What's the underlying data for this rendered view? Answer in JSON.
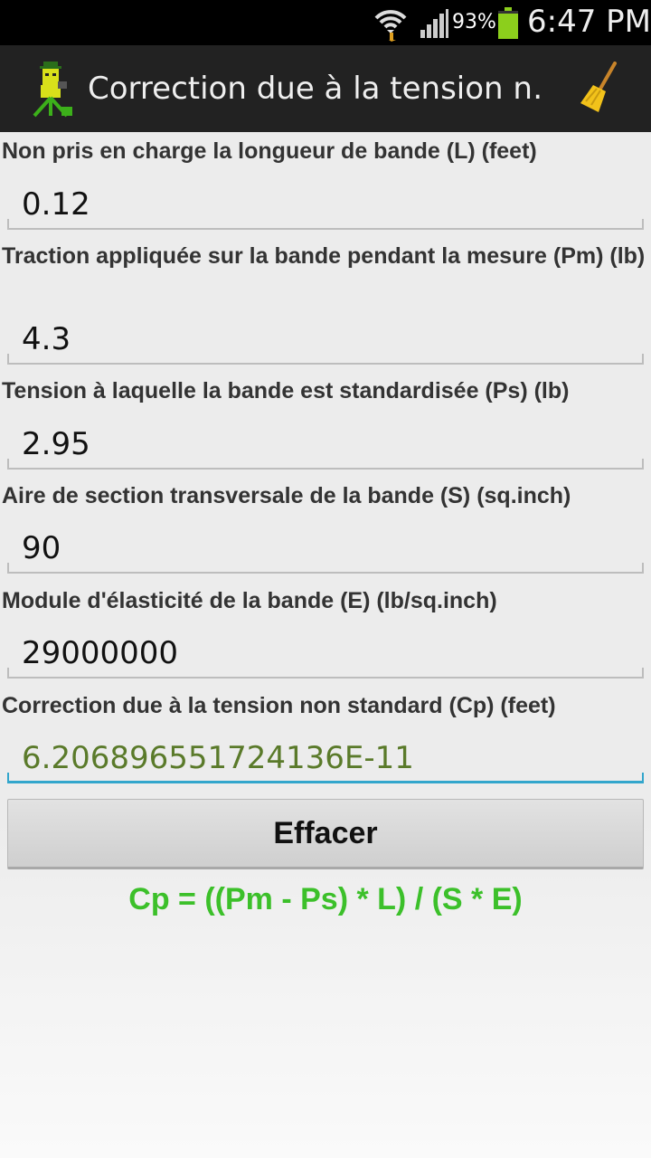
{
  "status_bar": {
    "battery_percent": "93%",
    "time": "6:47 PM",
    "icons": [
      "wifi-icon",
      "signal-icon",
      "battery-icon"
    ]
  },
  "action_bar": {
    "title": "Correction due à la tension n…",
    "icons": [
      "app-logo-icon",
      "broom-icon"
    ]
  },
  "fields": [
    {
      "label": "Non pris en charge la longueur de bande (L) (feet)",
      "value": "0.12"
    },
    {
      "label": "Traction appliquée sur la bande pendant la mesure (Pm) (lb)",
      "value": "4.3"
    },
    {
      "label": "Tension à laquelle la bande est standardisée (Ps) (lb)",
      "value": "2.95"
    },
    {
      "label": "Aire de section transversale de la bande (S) (sq.inch)",
      "value": "90"
    },
    {
      "label": "Module d'élasticité de la bande (E) (lb/sq.inch)",
      "value": "29000000"
    },
    {
      "label": "Correction due à la tension non standard (Cp) (feet)",
      "value": "6.206896551724136E-11"
    }
  ],
  "clear_button": "Effacer",
  "formula": "Cp = ((Pm - Ps) * L) / (S * E)",
  "colors": {
    "result_text": "#5a7a2a",
    "formula_text": "#3cc02a",
    "focus_underline": "#33a6cc"
  }
}
